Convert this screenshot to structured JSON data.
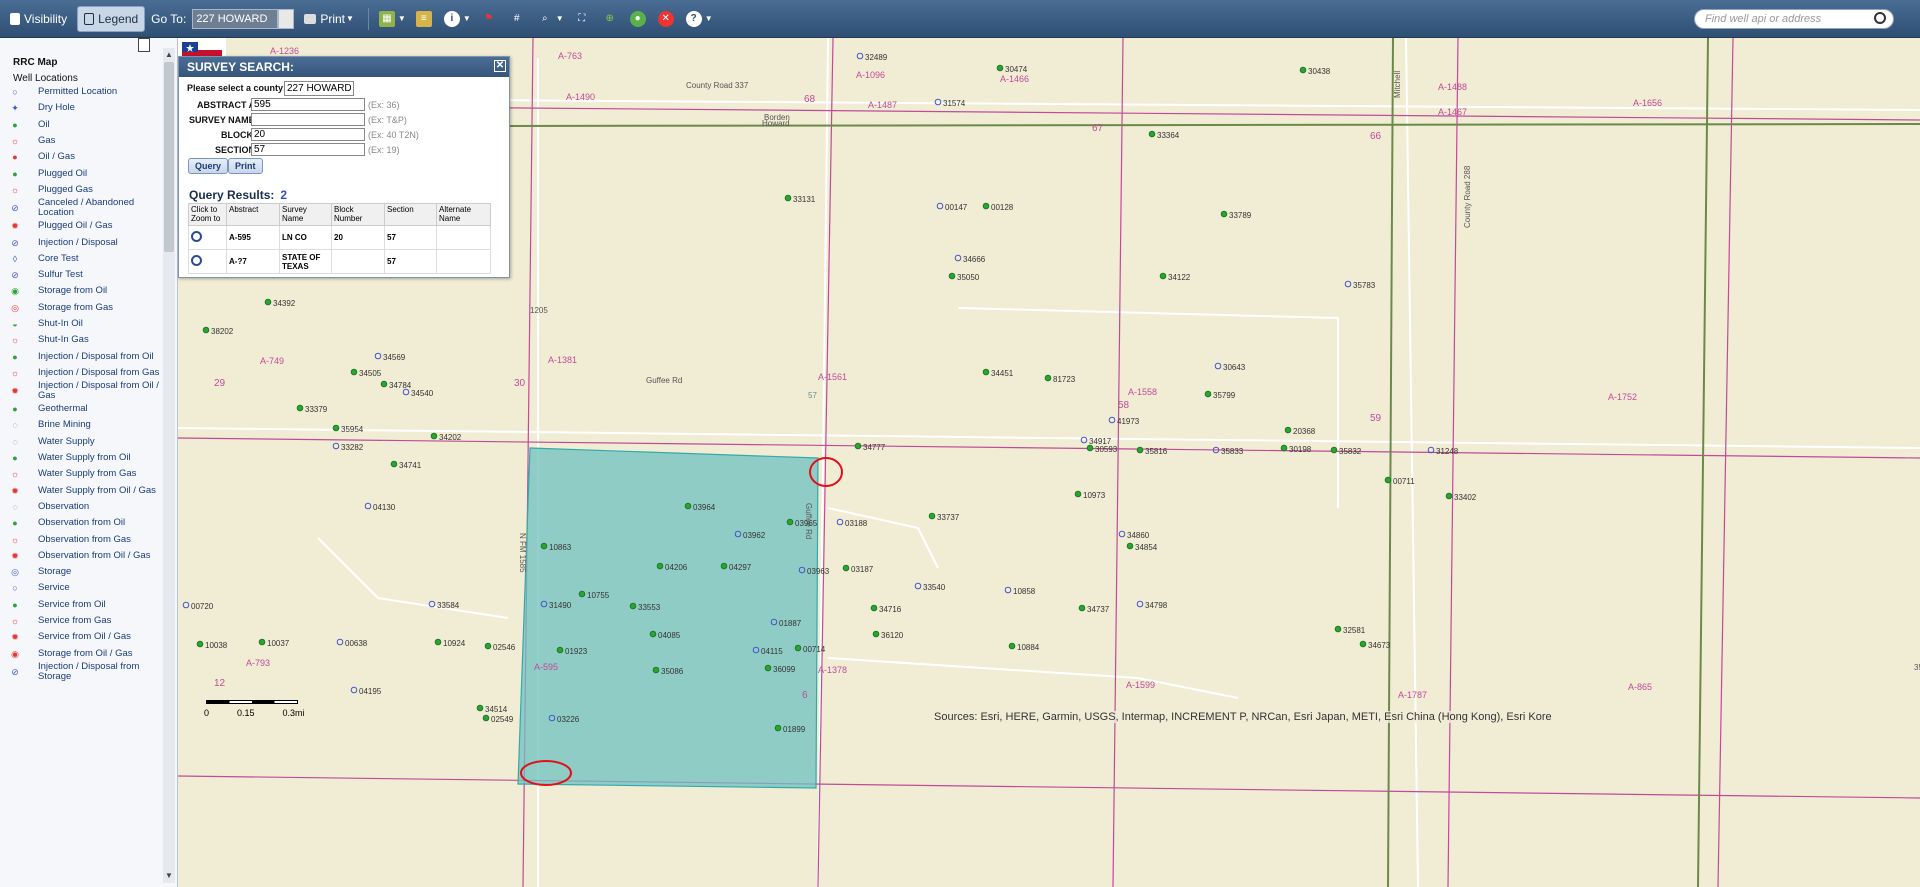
{
  "toolbar": {
    "visibility_label": "Visibility",
    "legend_label": "Legend",
    "goto_label": "Go To:",
    "goto_value": "227 HOWARD",
    "print_label": "Print",
    "search_placeholder": "Find well api or address"
  },
  "sidebar": {
    "title": "RRC Map",
    "subtitle": "Well Locations",
    "items": [
      {
        "label": "Permitted Location",
        "symbol": "open-circle"
      },
      {
        "label": "Dry Hole",
        "symbol": "dry-hole"
      },
      {
        "label": "Oil",
        "symbol": "green-dot"
      },
      {
        "label": "Gas",
        "symbol": "gas-star"
      },
      {
        "label": "Oil / Gas",
        "symbol": "oil-gas"
      },
      {
        "label": "Plugged Oil",
        "symbol": "plugged-oil"
      },
      {
        "label": "Plugged Gas",
        "symbol": "plugged-gas"
      },
      {
        "label": "Canceled / Abandoned Location",
        "symbol": "canceled"
      },
      {
        "label": "Plugged Oil / Gas",
        "symbol": "plugged-oil-gas"
      },
      {
        "label": "Injection / Disposal",
        "symbol": "injection"
      },
      {
        "label": "Core Test",
        "symbol": "core-test"
      },
      {
        "label": "Sulfur Test",
        "symbol": "sulfur"
      },
      {
        "label": "Storage from Oil",
        "symbol": "storage-oil"
      },
      {
        "label": "Storage from Gas",
        "symbol": "storage-gas"
      },
      {
        "label": "Shut-In Oil",
        "symbol": "shut-in-oil"
      },
      {
        "label": "Shut-In Gas",
        "symbol": "shut-in-gas"
      },
      {
        "label": "Injection / Disposal from Oil",
        "symbol": "inj-oil"
      },
      {
        "label": "Injection / Disposal from Gas",
        "symbol": "inj-gas"
      },
      {
        "label": "Injection / Disposal from Oil / Gas",
        "symbol": "inj-oil-gas"
      },
      {
        "label": "Geothermal",
        "symbol": "geothermal"
      },
      {
        "label": "Brine Mining",
        "symbol": "brine"
      },
      {
        "label": "Water Supply",
        "symbol": "water"
      },
      {
        "label": "Water Supply from Oil",
        "symbol": "water-oil"
      },
      {
        "label": "Water Supply from Gas",
        "symbol": "water-gas"
      },
      {
        "label": "Water Supply from Oil / Gas",
        "symbol": "water-oil-gas"
      },
      {
        "label": "Observation",
        "symbol": "observation"
      },
      {
        "label": "Observation from Oil",
        "symbol": "obs-oil"
      },
      {
        "label": "Observation from Gas",
        "symbol": "obs-gas"
      },
      {
        "label": "Observation from Oil / Gas",
        "symbol": "obs-oil-gas"
      },
      {
        "label": "Storage",
        "symbol": "storage"
      },
      {
        "label": "Service",
        "symbol": "service"
      },
      {
        "label": "Service from Oil",
        "symbol": "service-oil"
      },
      {
        "label": "Service from Gas",
        "symbol": "service-gas"
      },
      {
        "label": "Service from Oil / Gas",
        "symbol": "service-oil-gas"
      },
      {
        "label": "Storage from Oil / Gas",
        "symbol": "storage-oil-gas"
      },
      {
        "label": "Injection / Disposal from Storage",
        "symbol": "inj-storage"
      }
    ]
  },
  "dialog": {
    "title": "SURVEY SEARCH:",
    "county_label": "Please select a county:",
    "county_value": "227 HOWARD",
    "abstract_label": "ABSTRACT A-",
    "abstract_value": "595",
    "abstract_hint": "(Ex: 36)",
    "survey_label": "SURVEY NAME",
    "survey_value": "",
    "survey_hint": "(Ex: T&P)",
    "block_label": "BLOCK",
    "block_value": "20",
    "block_hint": "(Ex: 40 T2N)",
    "section_label": "SECTION",
    "section_value": "57",
    "section_hint": "(Ex: 19)",
    "query_button": "Query",
    "print_button": "Print",
    "results_title": "Query Results:",
    "results_count": "2",
    "columns": [
      "Click to Zoom to",
      "Abstract",
      "Survey Name",
      "Block Number",
      "Section",
      "Alternate Name"
    ],
    "rows": [
      {
        "abstract": "A-595",
        "survey": "LN CO",
        "block": "20",
        "section": "57",
        "alternate": ""
      },
      {
        "abstract": "A-?7",
        "survey": "STATE OF TEXAS",
        "block": "",
        "section": "57",
        "alternate": ""
      }
    ]
  },
  "map": {
    "attribution": "Sources: Esri, HERE, Garmin, USGS, Intermap, INCREMENT P, NRCan, Esri Japan, METI, Esri China (Hong Kong), Esri Kore",
    "scale_labels": [
      "0",
      "0.15",
      "0.3mi"
    ],
    "abstract_labels": [
      "A-1236",
      "A-763",
      "A-1490",
      "A-1096",
      "A-1466",
      "A-1488",
      "A-1656",
      "A-1487",
      "A-1467",
      "A-749",
      "A-1381",
      "A-1561",
      "A-1558",
      "A-1752",
      "A-793",
      "A-1378",
      "A-1599",
      "A-865",
      "A-595",
      "A-1787"
    ],
    "section_labels": [
      "68",
      "67",
      "66",
      "29",
      "30",
      "58",
      "59",
      "12",
      "6",
      "57"
    ],
    "road_labels": [
      "County Road 337",
      "Guffee Rd",
      "County Road 288",
      "Mitchell",
      "Borden",
      "Howard",
      "N FM 1585",
      "Guffee Rd",
      "1205",
      "350"
    ],
    "well_labels": [
      "32489",
      "30474",
      "30438",
      "31574",
      "33364",
      "33131",
      "00147",
      "00128",
      "33789",
      "34666",
      "35050",
      "34122",
      "35783",
      "34392",
      "38202",
      "34569",
      "34505",
      "34784",
      "34540",
      "33379",
      "35954",
      "33282",
      "34202",
      "34741",
      "04130",
      "34451",
      "81723",
      "30643",
      "35799",
      "34777",
      "34917",
      "30593",
      "35816",
      "35833",
      "30198",
      "35832",
      "31248",
      "20368",
      "33737",
      "03188",
      "03964",
      "03965",
      "03962",
      "04206",
      "04297",
      "03963",
      "10863",
      "10755",
      "31490",
      "33553",
      "04085",
      "01887",
      "01923",
      "35086",
      "04115",
      "00714",
      "36099",
      "33584",
      "10924",
      "02546",
      "04195",
      "34514",
      "02549",
      "03226",
      "01899",
      "03187",
      "33540",
      "34716",
      "36120",
      "10858",
      "10884",
      "34737",
      "34798",
      "32581",
      "34673",
      "00720",
      "10038",
      "10037",
      "00638",
      "33402",
      "00711",
      "34860",
      "34854",
      "10973",
      "41973"
    ],
    "colors": {
      "land": "#f1ecd4",
      "selected_parcel": "#6fc1c1",
      "survey_line": "#c04b9a",
      "annotation": "#e0101a",
      "road": "#ffffff"
    }
  }
}
